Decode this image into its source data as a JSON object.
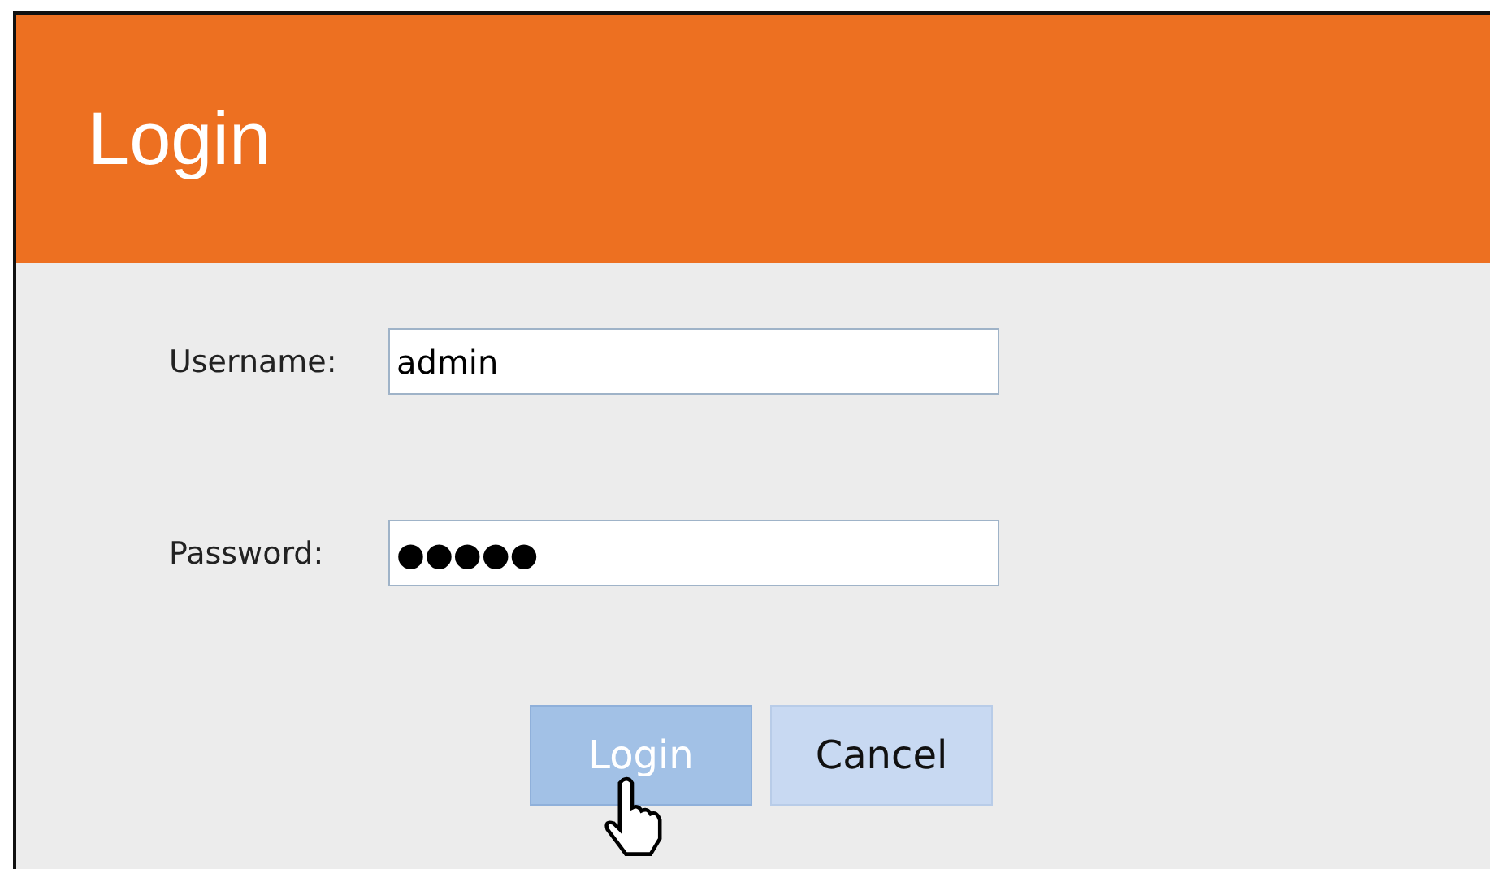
{
  "window": {
    "title": "Login"
  },
  "fields": [
    {
      "label": "Username:",
      "value": "admin"
    },
    {
      "label": "Password:",
      "value": "●●●●●"
    }
  ],
  "buttons": [
    {
      "label": "Login",
      "hovered": true
    },
    {
      "label": "Cancel",
      "hovered": false
    }
  ]
}
